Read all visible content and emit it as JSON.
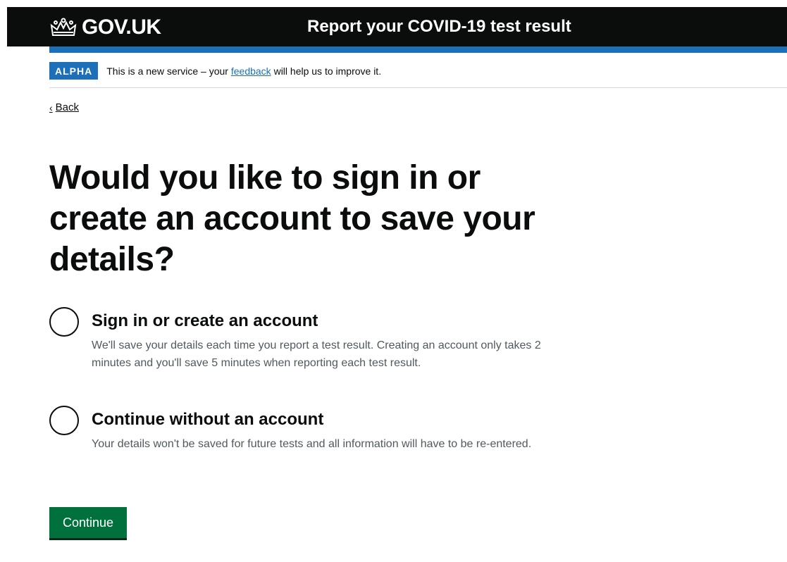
{
  "header": {
    "logo_text": "GOV.UK",
    "service_name": "Report your COVID-19 test result"
  },
  "phase_banner": {
    "tag": "ALPHA",
    "text_before": "This is a new service – your ",
    "link_text": "feedback",
    "text_after": " will help us to improve it."
  },
  "back_link": {
    "label": "Back"
  },
  "page_title": "Would you like to sign in or create an account to save your details?",
  "options": [
    {
      "label": "Sign in or create an account",
      "hint": "We'll save your details each time you report a test result. Creating an account only takes 2 minutes and you'll save 5 minutes when reporting each test result.",
      "selected": false
    },
    {
      "label": "Continue without an account",
      "hint": "Your details won't be saved for future tests and all information will have to be re-entered.",
      "selected": false
    }
  ],
  "continue_button": {
    "label": "Continue"
  },
  "colors": {
    "header_bg": "#0b0c0c",
    "accent_blue": "#1d70b8",
    "button_green": "#00703c"
  }
}
